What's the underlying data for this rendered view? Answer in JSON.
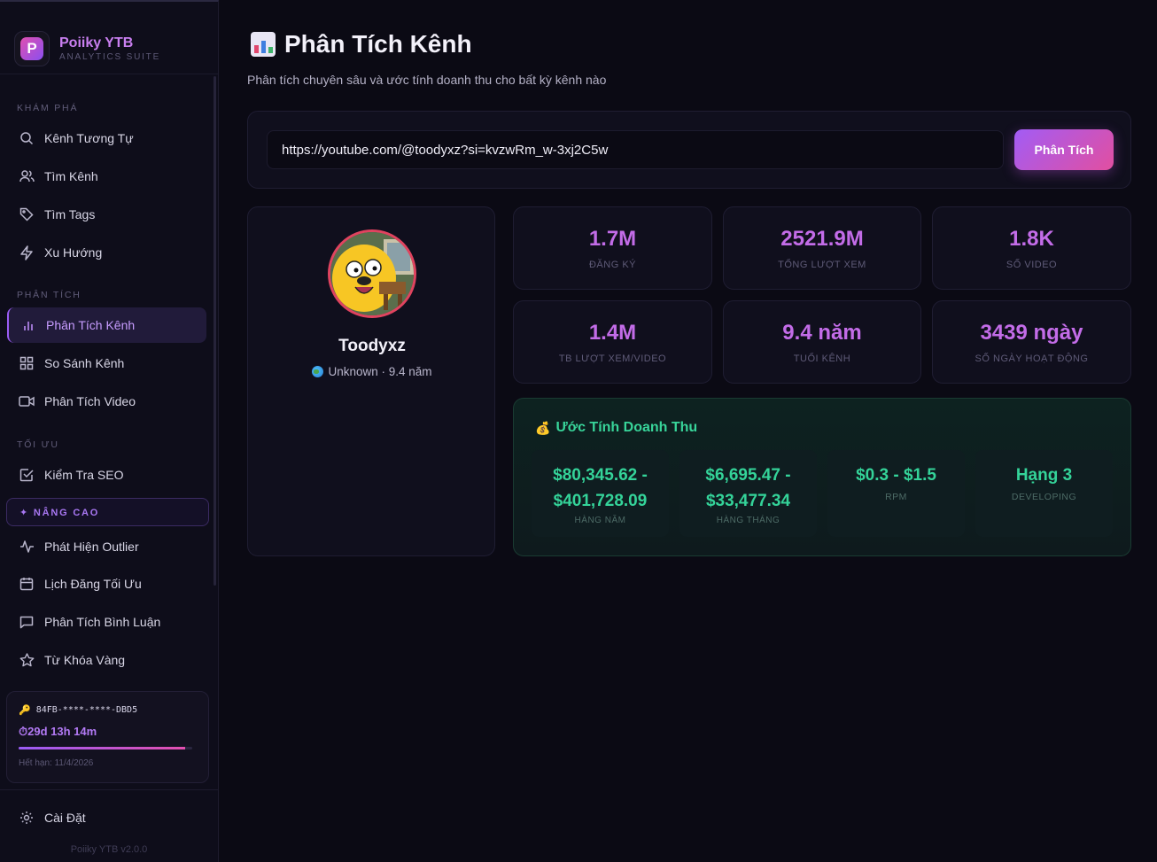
{
  "brand": {
    "name": "Poiiky YTB",
    "subtitle": "ANALYTICS SUITE",
    "logo_letter": "P"
  },
  "sidebar": {
    "sections": {
      "explore": "KHÁM PHÁ",
      "analysis": "PHÂN TÍCH",
      "optimize": "TỐI ƯU",
      "advanced": "✦ NÂNG CAO"
    },
    "items": [
      {
        "label": "Kênh Tương Tự",
        "icon": "search-icon"
      },
      {
        "label": "Tìm Kênh",
        "icon": "users-icon"
      },
      {
        "label": "Tìm Tags",
        "icon": "tag-icon"
      },
      {
        "label": "Xu Hướng",
        "icon": "lightning-icon"
      },
      {
        "label": "Phân Tích Kênh",
        "icon": "bar-chart-icon",
        "active": true
      },
      {
        "label": "So Sánh Kênh",
        "icon": "grid-icon"
      },
      {
        "label": "Phân Tích Video",
        "icon": "video-icon"
      },
      {
        "label": "Kiểm Tra SEO",
        "icon": "checkbox-icon"
      },
      {
        "label": "Phát Hiện Outlier",
        "icon": "pulse-icon"
      },
      {
        "label": "Lịch Đăng Tối Ưu",
        "icon": "calendar-icon"
      },
      {
        "label": "Phân Tích Bình Luận",
        "icon": "comment-icon"
      },
      {
        "label": "Từ Khóa Vàng",
        "icon": "star-icon"
      }
    ],
    "settings_label": "Cài Đặt",
    "version": "Poiiky YTB v2.0.0"
  },
  "license": {
    "key": "84FB-****-****-DBD5",
    "time_left": "⏱29d 13h 14m",
    "progress": 0.96,
    "expiry": "Hết hạn: 11/4/2026"
  },
  "page": {
    "title": "Phân Tích Kênh",
    "subtitle": "Phân tích chuyên sâu và ước tính doanh thu cho bất kỳ kênh nào"
  },
  "search": {
    "url_value": "https://youtube.com/@toodyxz?si=kvzwRm_w-3xj2C5w",
    "button_label": "Phân Tích"
  },
  "channel": {
    "name": "Toodyxz",
    "meta": "Unknown · 9.4 năm"
  },
  "stats": [
    {
      "value": "1.7M",
      "label": "ĐĂNG KÝ"
    },
    {
      "value": "2521.9M",
      "label": "TỔNG LƯỢT XEM"
    },
    {
      "value": "1.8K",
      "label": "SỐ VIDEO"
    },
    {
      "value": "1.4M",
      "label": "TB LƯỢT XEM/VIDEO"
    },
    {
      "value": "9.4 năm",
      "label": "TUỔI KÊNH"
    },
    {
      "value": "3439 ngày",
      "label": "SỐ NGÀY HOẠT ĐỘNG"
    }
  ],
  "revenue": {
    "title": "Ước Tính Doanh Thu",
    "yearly": {
      "line1": "$80,345.62 -",
      "line2": "$401,728.09",
      "label": "HÀNG NĂM"
    },
    "monthly": {
      "line1": "$6,695.47 -",
      "line2": "$33,477.34",
      "label": "HÀNG THÁNG"
    },
    "rpm": {
      "value": "$0.3 - $1.5",
      "label": "RPM"
    },
    "tier": {
      "value": "Hạng 3",
      "label": "DEVELOPING"
    }
  },
  "colors": {
    "accent_purple": "#9a5cf5",
    "accent_pink": "#e24fb0",
    "stat_value": "#c36ce8",
    "revenue_green": "#34d399"
  }
}
